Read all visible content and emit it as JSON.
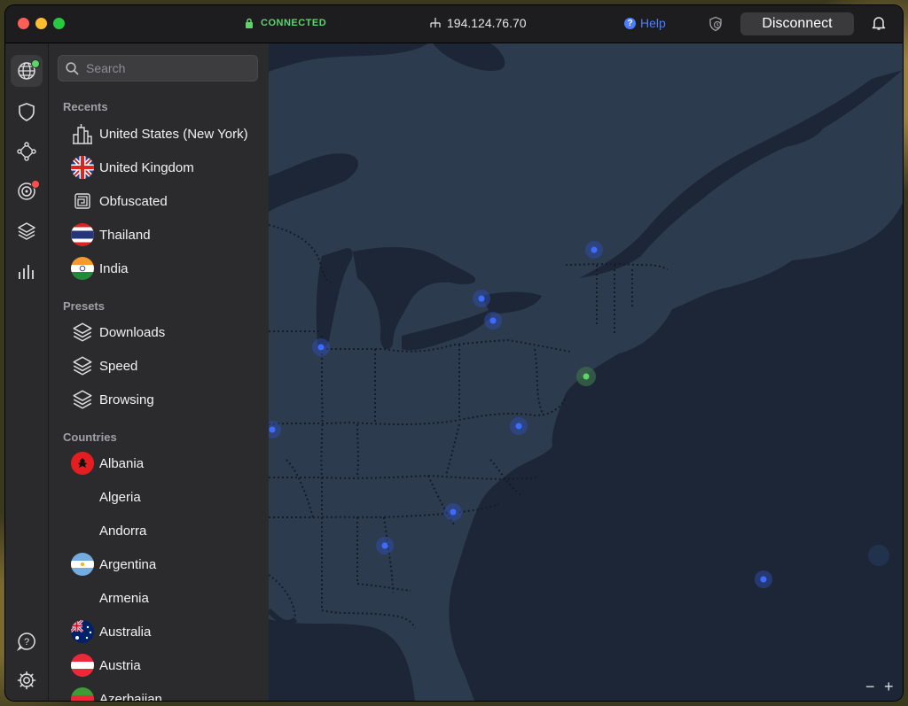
{
  "titlebar": {
    "status": "CONNECTED",
    "ip": "194.124.76.70",
    "help": "Help",
    "disconnect": "Disconnect"
  },
  "rail": {
    "items": [
      "globe-icon",
      "shield-icon",
      "meshnet-icon",
      "target-icon",
      "layers-icon",
      "stats-icon"
    ],
    "bottom": [
      "help-icon",
      "gear-icon"
    ]
  },
  "search": {
    "placeholder": "Search"
  },
  "recents": {
    "title": "Recents",
    "items": [
      {
        "label": "United States (New York)",
        "icon": "city-icon"
      },
      {
        "label": "United Kingdom",
        "icon": "uk-flag"
      },
      {
        "label": "Obfuscated",
        "icon": "obfuscated-icon"
      },
      {
        "label": "Thailand",
        "icon": "thailand-flag"
      },
      {
        "label": "India",
        "icon": "india-flag"
      }
    ]
  },
  "presets": {
    "title": "Presets",
    "items": [
      {
        "label": "Downloads",
        "icon": "layers-icon"
      },
      {
        "label": "Speed",
        "icon": "layers-icon"
      },
      {
        "label": "Browsing",
        "icon": "layers-icon"
      }
    ]
  },
  "countries": {
    "title": "Countries",
    "items": [
      {
        "label": "Albania",
        "icon": "albania-flag"
      },
      {
        "label": "Algeria",
        "icon": ""
      },
      {
        "label": "Andorra",
        "icon": ""
      },
      {
        "label": "Argentina",
        "icon": "argentina-flag"
      },
      {
        "label": "Armenia",
        "icon": ""
      },
      {
        "label": "Australia",
        "icon": "australia-flag"
      },
      {
        "label": "Austria",
        "icon": "austria-flag"
      },
      {
        "label": "Azerbaijan",
        "icon": "azerbaijan-flag"
      }
    ]
  },
  "map": {
    "zoom_out": "−",
    "zoom_in": "+",
    "colors": {
      "land": "#2c3b4e",
      "water": "#1c2636",
      "server": "#3d6bff",
      "connected": "#5fd36a"
    }
  }
}
